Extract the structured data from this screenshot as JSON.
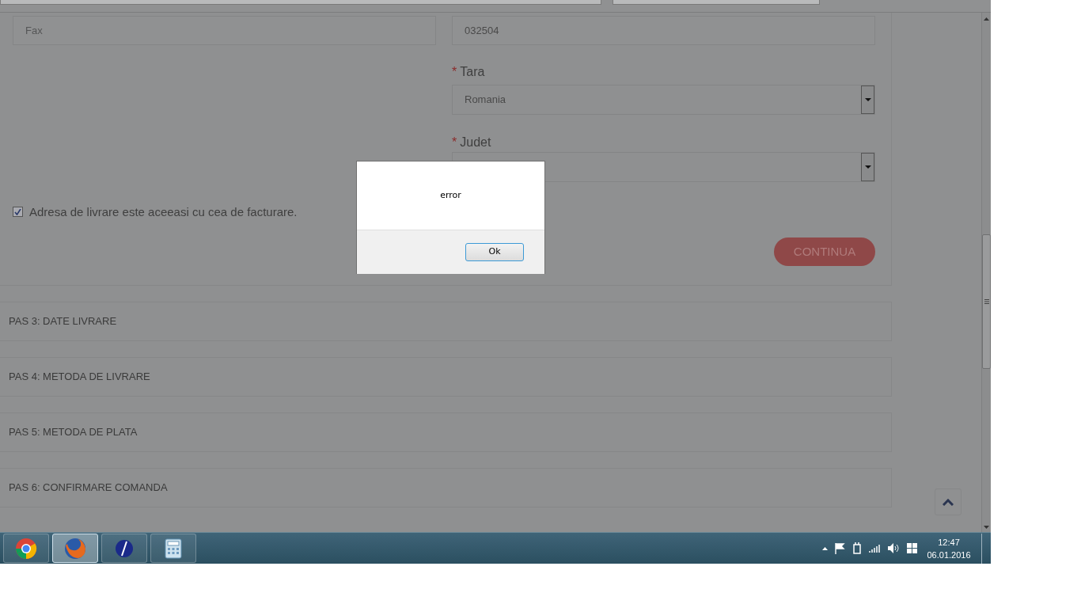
{
  "form": {
    "fax": {
      "placeholder": "Fax"
    },
    "phone": {
      "value": "032504"
    },
    "country": {
      "required_mark": "*",
      "label": "Tara",
      "value": "Romania"
    },
    "county": {
      "required_mark": "*",
      "label": "Judet"
    },
    "same_address": {
      "label": "Adresa de livrare este aceeasi cu cea de facturare.",
      "checked": true
    },
    "continue_button": "CONTINUA"
  },
  "steps": [
    {
      "label": "PAS 3: DATE LIVRARE"
    },
    {
      "label": "PAS 4: METODA DE LIVRARE"
    },
    {
      "label": "PAS 5: METODA DE PLATA"
    },
    {
      "label": "PAS 6: CONFIRMARE COMANDA"
    }
  ],
  "dialog": {
    "message": "error",
    "ok_button": "Ok"
  },
  "taskbar": {
    "apps": [
      {
        "kind": "chrome",
        "active": false
      },
      {
        "kind": "firefox",
        "active": true
      },
      {
        "kind": "slash",
        "active": false
      },
      {
        "kind": "calculator",
        "active": false
      }
    ],
    "clock": {
      "time": "12:47",
      "date": "06.01.2016"
    }
  }
}
